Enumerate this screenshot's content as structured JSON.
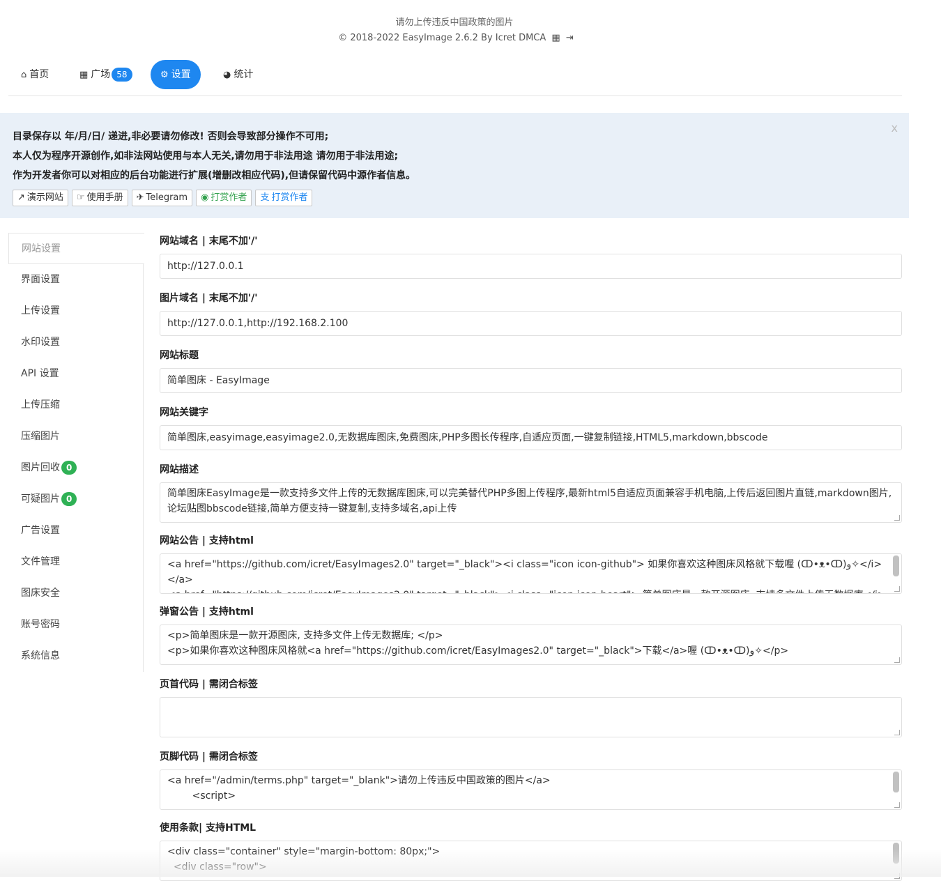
{
  "header": {
    "notice": "请勿上传违反中国政策的图片",
    "copyright": "© 2018-2022 EasyImage 2.6.2 By Icret DMCA",
    "qr_icon": "qrcode-icon",
    "logout_icon": "logout-icon"
  },
  "nav": {
    "home": "首页",
    "plaza": "广场",
    "plaza_count": "58",
    "settings": "设置",
    "stats": "统计"
  },
  "alert": {
    "close": "x",
    "lines": [
      "目录保存以 年/月/日/ 递进,非必要请勿修改! 否则会导致部分操作不可用;",
      "本人仅为程序开源创作,如非法网站使用与本人无关,请勿用于非法用途 请勿用于非法用途;",
      "作为开发者你可以对相应的后台功能进行扩展(增删改相应代码),但请保留代码中源作者信息。"
    ],
    "buttons": {
      "demo": "演示网站",
      "manual": "使用手册",
      "telegram": "Telegram",
      "donate_wechat": "打赏作者",
      "donate_alipay": "打赏作者"
    }
  },
  "sidebar": {
    "items": [
      {
        "label": "网站设置"
      },
      {
        "label": "界面设置"
      },
      {
        "label": "上传设置"
      },
      {
        "label": "水印设置"
      },
      {
        "label": "API 设置"
      },
      {
        "label": "上传压缩"
      },
      {
        "label": "压缩图片"
      },
      {
        "label": "图片回收",
        "badge": "0"
      },
      {
        "label": "可疑图片",
        "badge": "0"
      },
      {
        "label": "广告设置"
      },
      {
        "label": "文件管理"
      },
      {
        "label": "图床安全"
      },
      {
        "label": "账号密码"
      },
      {
        "label": "系统信息"
      }
    ]
  },
  "form": {
    "domain_label": "网站域名 | 末尾不加'/'",
    "domain_value": "http://127.0.0.1",
    "img_domain_label": "图片域名 | 末尾不加'/'",
    "img_domain_value": "http://127.0.0.1,http://192.168.2.100",
    "title_label": "网站标题",
    "title_value": "简单图床 - EasyImage",
    "keywords_label": "网站关键字",
    "keywords_value": "简单图床,easyimage,easyimage2.0,无数据库图床,免费图床,PHP多图长传程序,自适应页面,一键复制链接,HTML5,markdown,bbscode",
    "desc_label": "网站描述",
    "desc_value": "简单图床EasyImage是一款支持多文件上传的无数据库图床,可以完美替代PHP多图上传程序,最新html5自适应页面兼容手机电脑,上传后返回图片直链,markdown图片,论坛贴图bbscode链接,简单方便支持一键复制,支持多域名,api上传",
    "announce_label": "网站公告 | 支持html",
    "announce_value": "<a href=\"https://github.com/icret/EasyImages2.0\" target=\"_black\"><i class=\"icon icon-github\"> 如果你喜欢这种图床风格就下载喔 (ↀ•ᴥ•ↀ)و✧</i></a>\n<a href=\"https://github.com/icret/EasyImages2.0\" target=\"_black\"><i class=\"icon icon-heart\"> 简单图床是一款开源图床, 支持多文件上传无数据库</i></a>",
    "popup_label": "弹窗公告 | 支持html",
    "popup_value": "<p>简单图床是一款开源图床, 支持多文件上传无数据库; </p>\n<p>如果你喜欢这种图床风格就<a href=\"https://github.com/icret/EasyImages2.0\" target=\"_black\">下载</a>喔 (ↀ•ᴥ•ↀ)و✧</p>",
    "header_code_label": "页首代码 | 需闭合标签",
    "header_code_value": "",
    "footer_code_label": "页脚代码 | 需闭合标签",
    "footer_code_value": "<a href=\"/admin/terms.php\" target=\"_blank\">请勿上传违反中国政策的图片</a>\n        <script>",
    "terms_label": "使用条款| 支持HTML",
    "terms_value": "<div class=\"container\" style=\"margin-bottom: 80px;\">\n  <div class=\"row\">"
  },
  "colors": {
    "accent": "#1e87f0",
    "alert_bg": "#e9f0f8",
    "badge_green": "#2fb155"
  }
}
